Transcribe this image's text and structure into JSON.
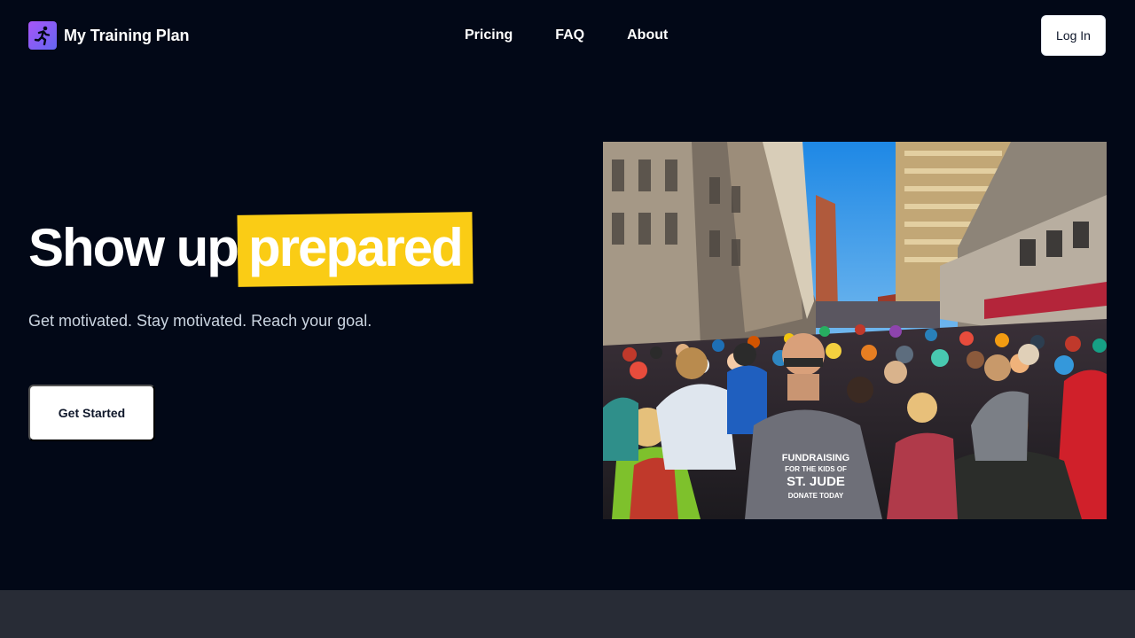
{
  "header": {
    "brand_name": "My Training Plan",
    "logo_icon": "runner-icon",
    "nav": [
      {
        "label": "Pricing"
      },
      {
        "label": "FAQ"
      },
      {
        "label": "About"
      }
    ],
    "login_label": "Log In"
  },
  "hero": {
    "title_plain": "Show up",
    "title_highlight": "prepared",
    "subtitle": "Get motivated. Stay motivated. Reach your goal.",
    "cta_label": "Get Started",
    "highlight_color": "#facc15",
    "image": {
      "subject": "crowd of marathon runners on a city street",
      "shirt_text": [
        "FUNDRAISING",
        "FOR THE KIDS OF",
        "ST. JUDE",
        "DONATE TODAY"
      ]
    }
  },
  "colors": {
    "background": "#020817",
    "footer": "#282c36",
    "logo_gradient": [
      "#a855f7",
      "#6366f1"
    ]
  }
}
